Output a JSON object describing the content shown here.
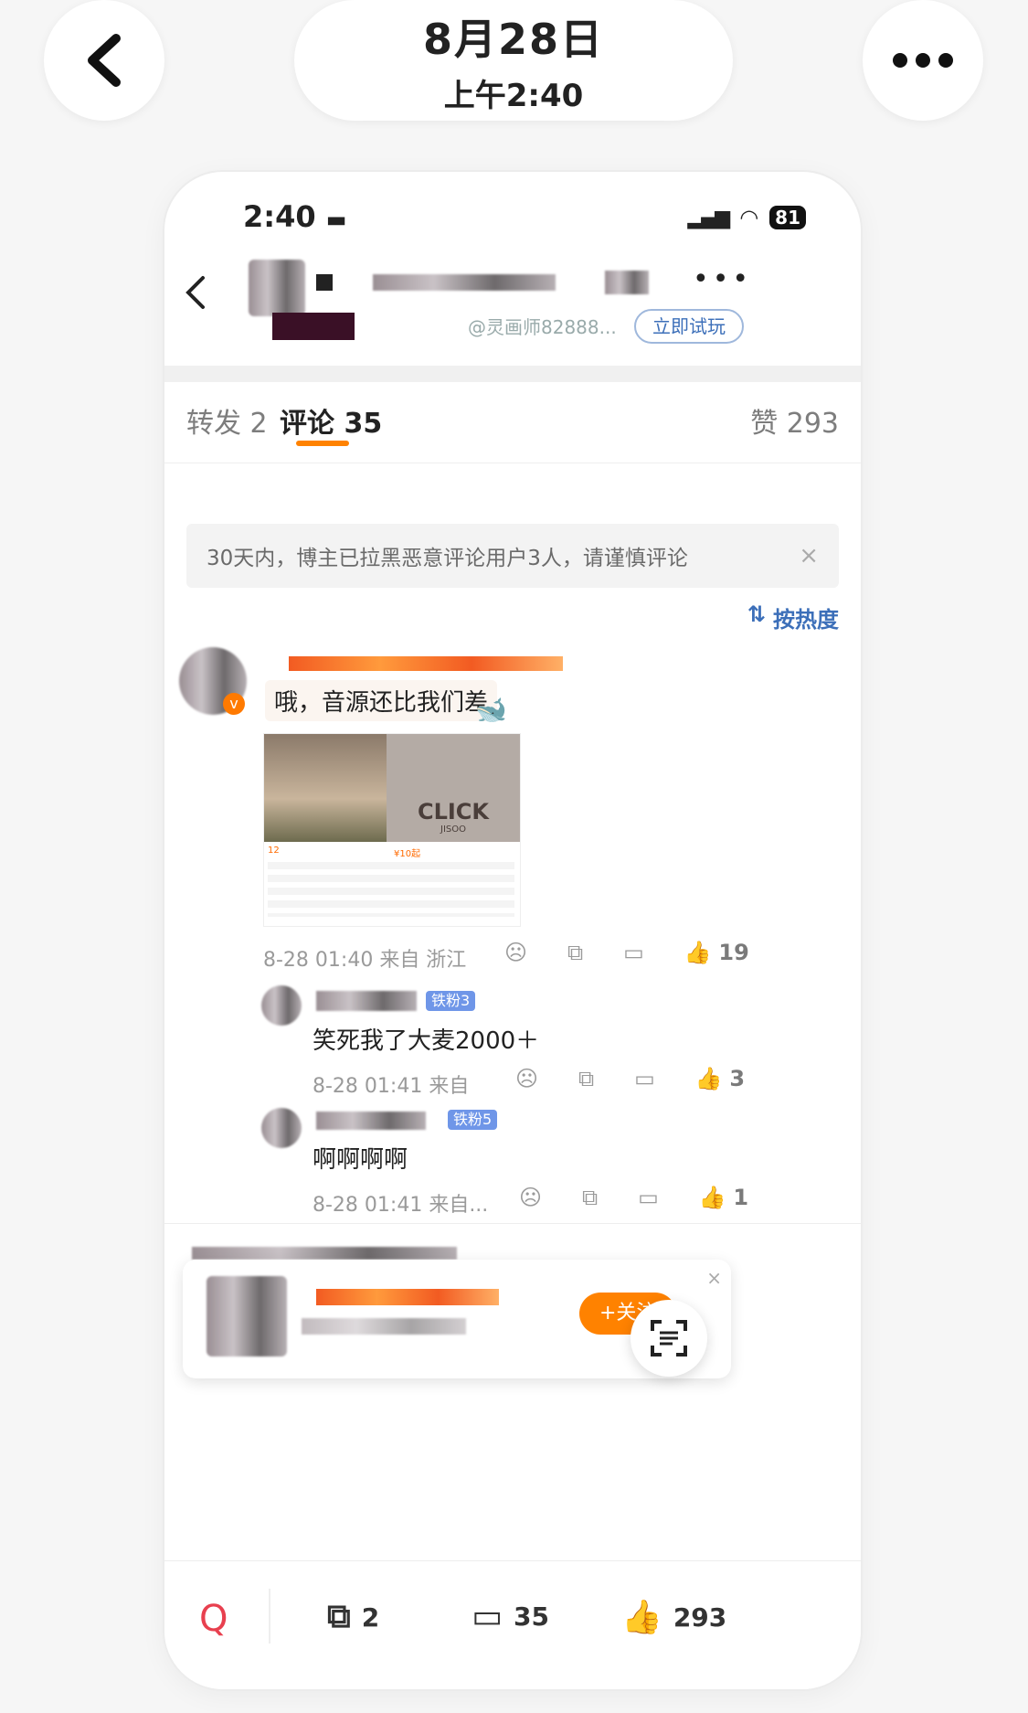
{
  "top": {
    "date": "8月28日",
    "time": "上午2:40"
  },
  "status": {
    "time": "2:40",
    "battery": "81"
  },
  "header": {
    "attribution": "@灵画师82888...",
    "try_button": "立即试玩"
  },
  "tabs": {
    "repost": "转发 2",
    "comments": "评论 35",
    "likes": "赞 293"
  },
  "notice": "30天内，博主已拉黑恶意评论用户3人，请谨慎评论",
  "sort_label": "按热度",
  "comments": [
    {
      "text": "哦，音源还比我们差",
      "meta": "8-28 01:40 来自 浙江",
      "likes": "19",
      "image_text": {
        "logo_top": "CLICK",
        "logo_bottom": "JISOO",
        "price": "¥10起",
        "small_label": "12"
      }
    },
    {
      "text": "笑死我了大麦2000＋",
      "badge": "铁粉3",
      "meta": "8-28 01:41 来自",
      "likes": "3"
    },
    {
      "text": "啊啊啊啊",
      "badge": "铁粉5",
      "meta": "8-28 01:41 来自...",
      "likes": "1"
    }
  ],
  "popup": {
    "follow": "+关注"
  },
  "bottom": {
    "reposts": "2",
    "comments": "35",
    "likes": "293"
  },
  "colors": {
    "accent": "#ff8200",
    "link": "#3c6fb9"
  }
}
